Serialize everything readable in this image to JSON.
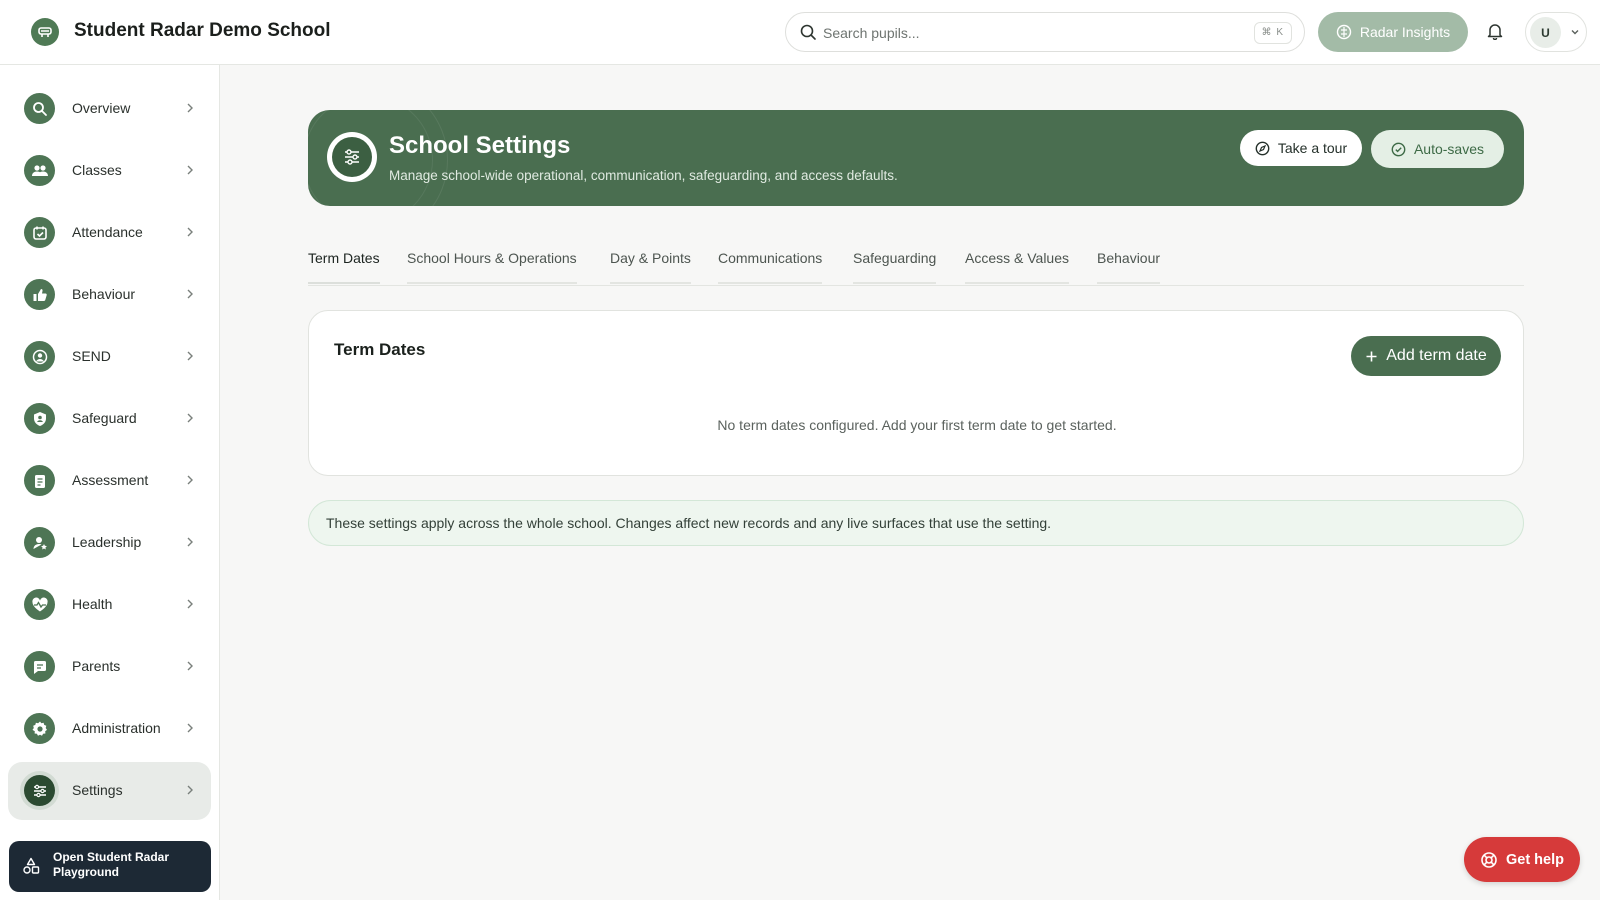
{
  "app": {
    "title": "Student Radar Demo School"
  },
  "search": {
    "placeholder": "Search pupils...",
    "shortcut": "⌘ K"
  },
  "topbar": {
    "insights_label": "Radar Insights",
    "avatar_initial": "U"
  },
  "sidebar": {
    "items": [
      {
        "label": "Overview",
        "icon": "search-icon"
      },
      {
        "label": "Classes",
        "icon": "users-icon"
      },
      {
        "label": "Attendance",
        "icon": "calendar-check-icon"
      },
      {
        "label": "Behaviour",
        "icon": "thumbs-up-icon"
      },
      {
        "label": "SEND",
        "icon": "user-circle-icon"
      },
      {
        "label": "Safeguard",
        "icon": "shield-user-icon"
      },
      {
        "label": "Assessment",
        "icon": "clipboard-list-icon"
      },
      {
        "label": "Leadership",
        "icon": "user-star-icon"
      },
      {
        "label": "Health",
        "icon": "heart-pulse-icon"
      },
      {
        "label": "Parents",
        "icon": "message-icon"
      },
      {
        "label": "Administration",
        "icon": "gear-icon"
      },
      {
        "label": "Settings",
        "icon": "sliders-icon",
        "active": true
      }
    ],
    "playground_label": "Open Student Radar Playground"
  },
  "header": {
    "title": "School Settings",
    "subtitle": "Manage school-wide operational, communication, safeguarding, and access defaults.",
    "tour_label": "Take a tour",
    "autosave_label": "Auto-saves"
  },
  "tabs": [
    {
      "label": "Term Dates",
      "active": true
    },
    {
      "label": "School Hours & Operations"
    },
    {
      "label": "Day & Points"
    },
    {
      "label": "Communications"
    },
    {
      "label": "Safeguarding"
    },
    {
      "label": "Access & Values"
    },
    {
      "label": "Behaviour"
    }
  ],
  "term_dates": {
    "title": "Term Dates",
    "add_label": "Add term date",
    "empty_message": "No term dates configured. Add your first term date to get started."
  },
  "info": {
    "text": "These settings apply across the whole school. Changes affect new records and any live surfaces that use the setting."
  },
  "help": {
    "label": "Get help"
  },
  "colors": {
    "brand": "#4a6e50",
    "sidebar_icon": "#4e7555",
    "help": "#d63a3a",
    "info_bg": "#eef6ef"
  }
}
